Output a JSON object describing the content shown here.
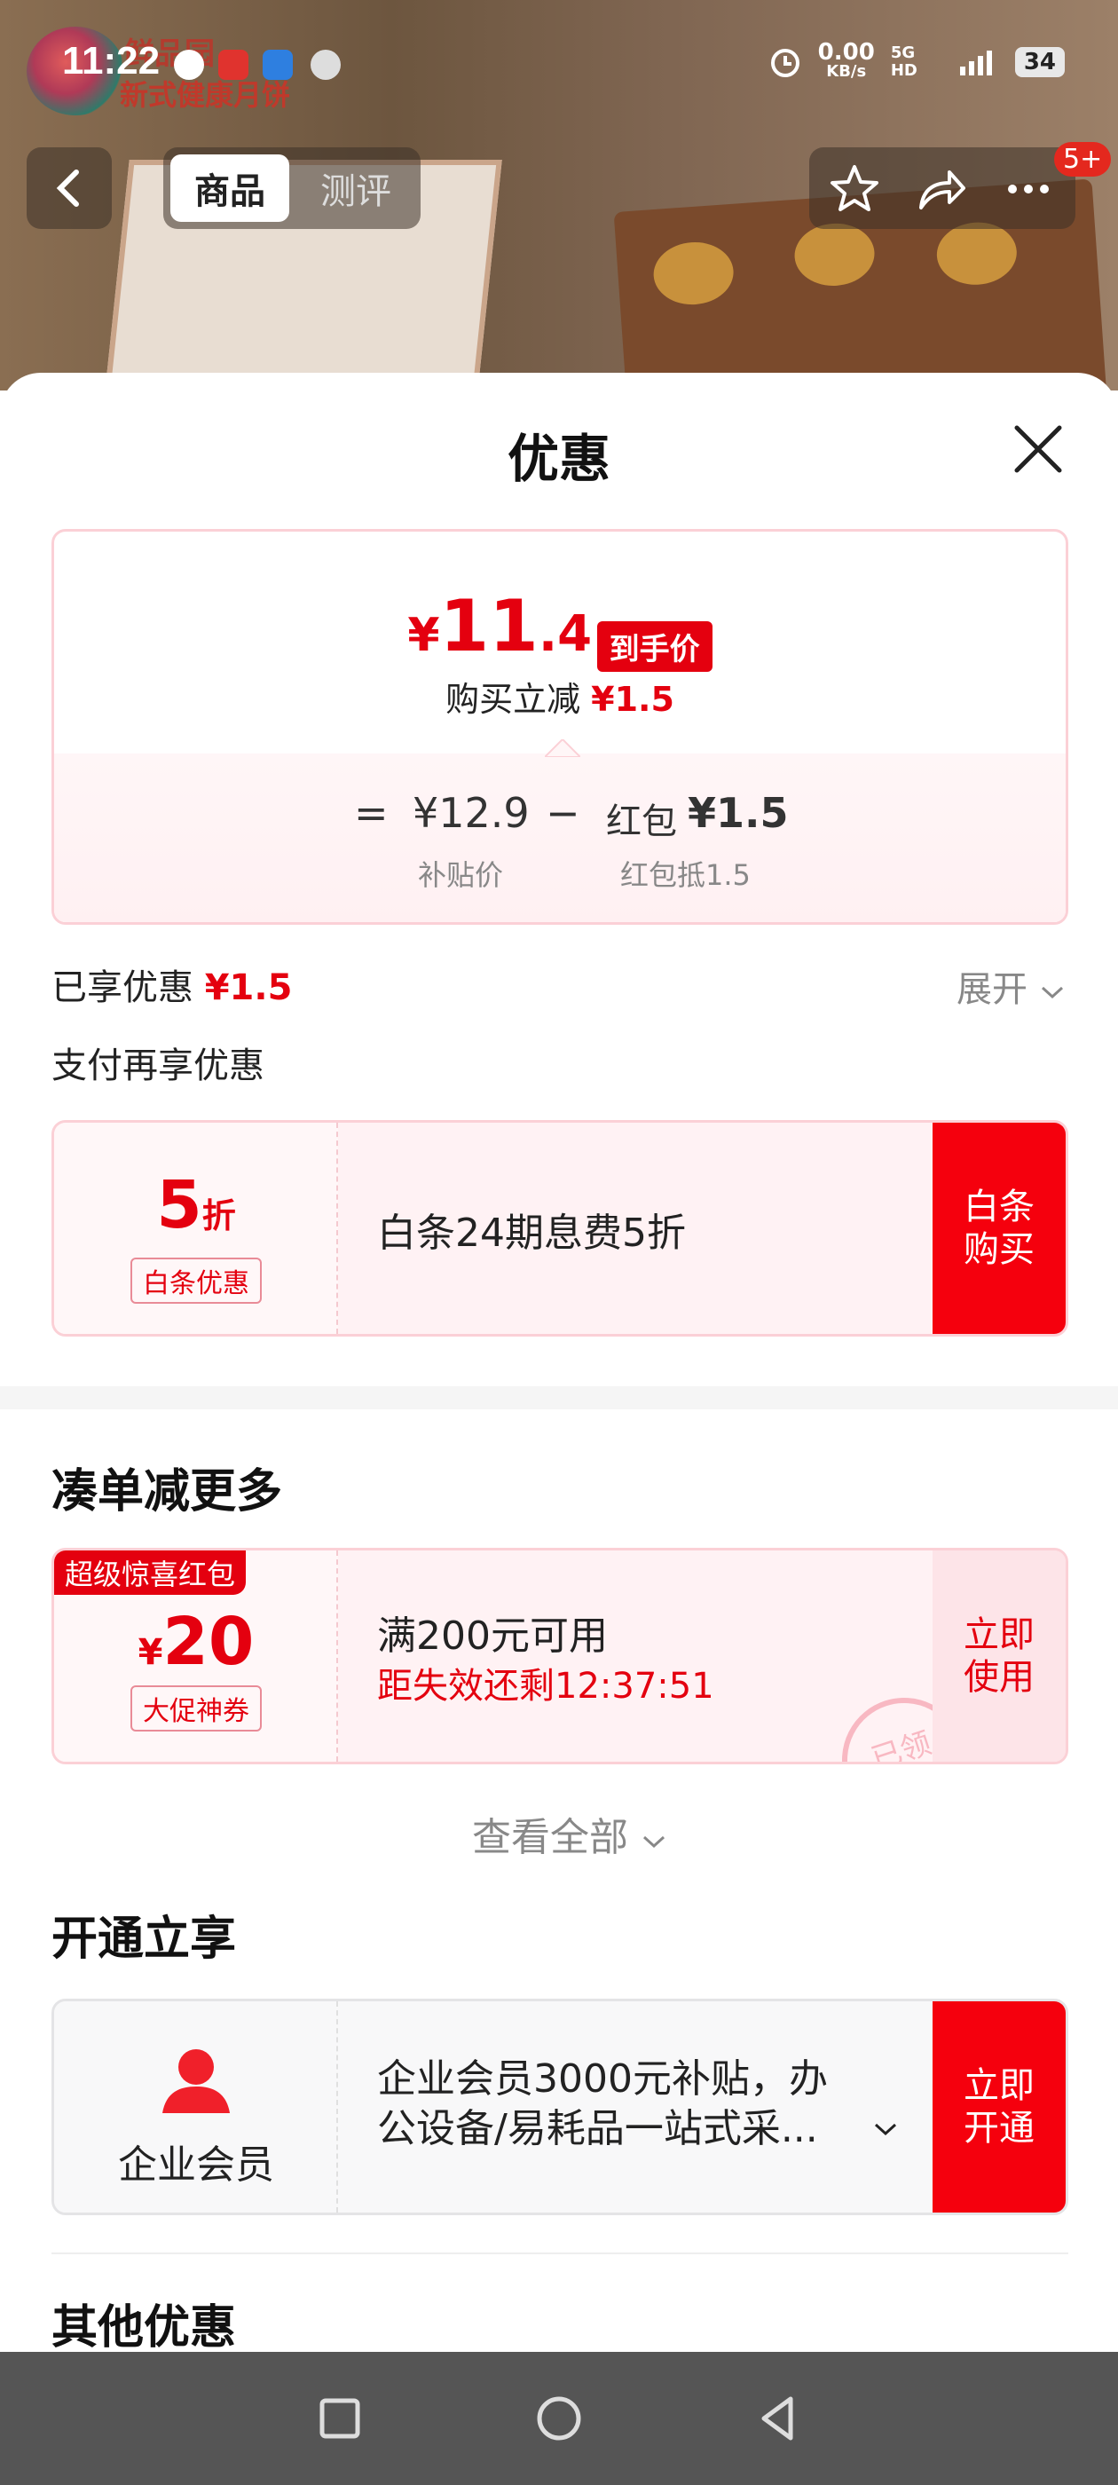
{
  "status_bar": {
    "time": "11:22",
    "speed": "0.00",
    "speed_unit": "KB/s",
    "network": "5G HD",
    "battery": "34"
  },
  "background": {
    "brand_line1": "鲜品园",
    "brand_line2": "新式健康月饼"
  },
  "top_nav": {
    "tab_goods": "商品",
    "tab_review": "测评",
    "more_badge": "5+"
  },
  "sheet": {
    "title": "优惠",
    "price_card": {
      "currency": "¥",
      "price_int": "11",
      "price_dec": ".4",
      "price_tag": "到手价",
      "discount_label": "购买立减",
      "discount_value": "¥1.5",
      "eq": "=",
      "subsidy_price": "¥12.9",
      "minus": "−",
      "redpack_label": "红包",
      "redpack_value": "¥1.5",
      "subsidy_caption": "补贴价",
      "redpack_caption": "红包抵1.5"
    },
    "enjoyed": {
      "label": "已享优惠",
      "value": "¥1.5",
      "expand": "展开"
    },
    "pay_more_label": "支付再享优惠",
    "baitiao_card": {
      "discount_num": "5",
      "discount_unit": "折",
      "tag": "白条优惠",
      "desc": "白条24期息费5折",
      "btn_line1": "白条",
      "btn_line2": "购买"
    },
    "combine_section": {
      "title": "凑单减更多",
      "coupon": {
        "corner": "超级惊喜红包",
        "currency": "¥",
        "amount": "20",
        "tag": "大促神券",
        "condition": "满200元可用",
        "countdown": "距失效还剩12:37:51",
        "btn_line1": "立即",
        "btn_line2": "使用",
        "stamp": "已领"
      },
      "view_all": "查看全部"
    },
    "open_section": {
      "title": "开通立享",
      "member": {
        "name": "企业会员",
        "desc_line1": "企业会员3000元补贴，办",
        "desc_line2": "公设备/易耗品一站式采...",
        "btn_line1": "立即",
        "btn_line2": "开通"
      }
    },
    "other_title": "其他优惠"
  },
  "colors": {
    "accent_red": "#e4000f",
    "card_border": "#fbd0d6"
  }
}
